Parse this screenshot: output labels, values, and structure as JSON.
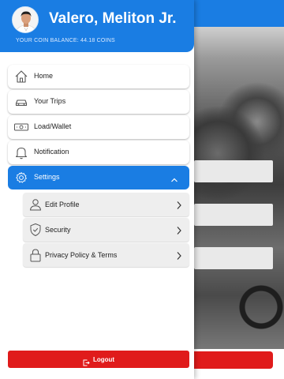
{
  "user": {
    "name": "Valero, Meliton Jr.",
    "coin_balance_text": "YOUR COIN BALANCE: 44.18 COINS"
  },
  "menu": {
    "items": [
      {
        "label": "Home",
        "icon": "home-icon"
      },
      {
        "label": "Your Trips",
        "icon": "car-icon"
      },
      {
        "label": "Load/Wallet",
        "icon": "cash-icon"
      },
      {
        "label": "Notification",
        "icon": "bell-icon"
      },
      {
        "label": "Settings",
        "icon": "gear-icon",
        "expanded": true
      }
    ],
    "settings_submenu": [
      {
        "label": "Edit Profile",
        "icon": "user-icon"
      },
      {
        "label": "Security",
        "icon": "shield-icon"
      },
      {
        "label": "Privacy Policy & Terms",
        "icon": "lock-icon"
      }
    ]
  },
  "logout": {
    "label": "Logout",
    "icon": "logout-icon"
  },
  "colors": {
    "primary_blue": "#1a7de3",
    "logout_red": "#e01b1b",
    "submenu_bg": "#eeeeee"
  }
}
